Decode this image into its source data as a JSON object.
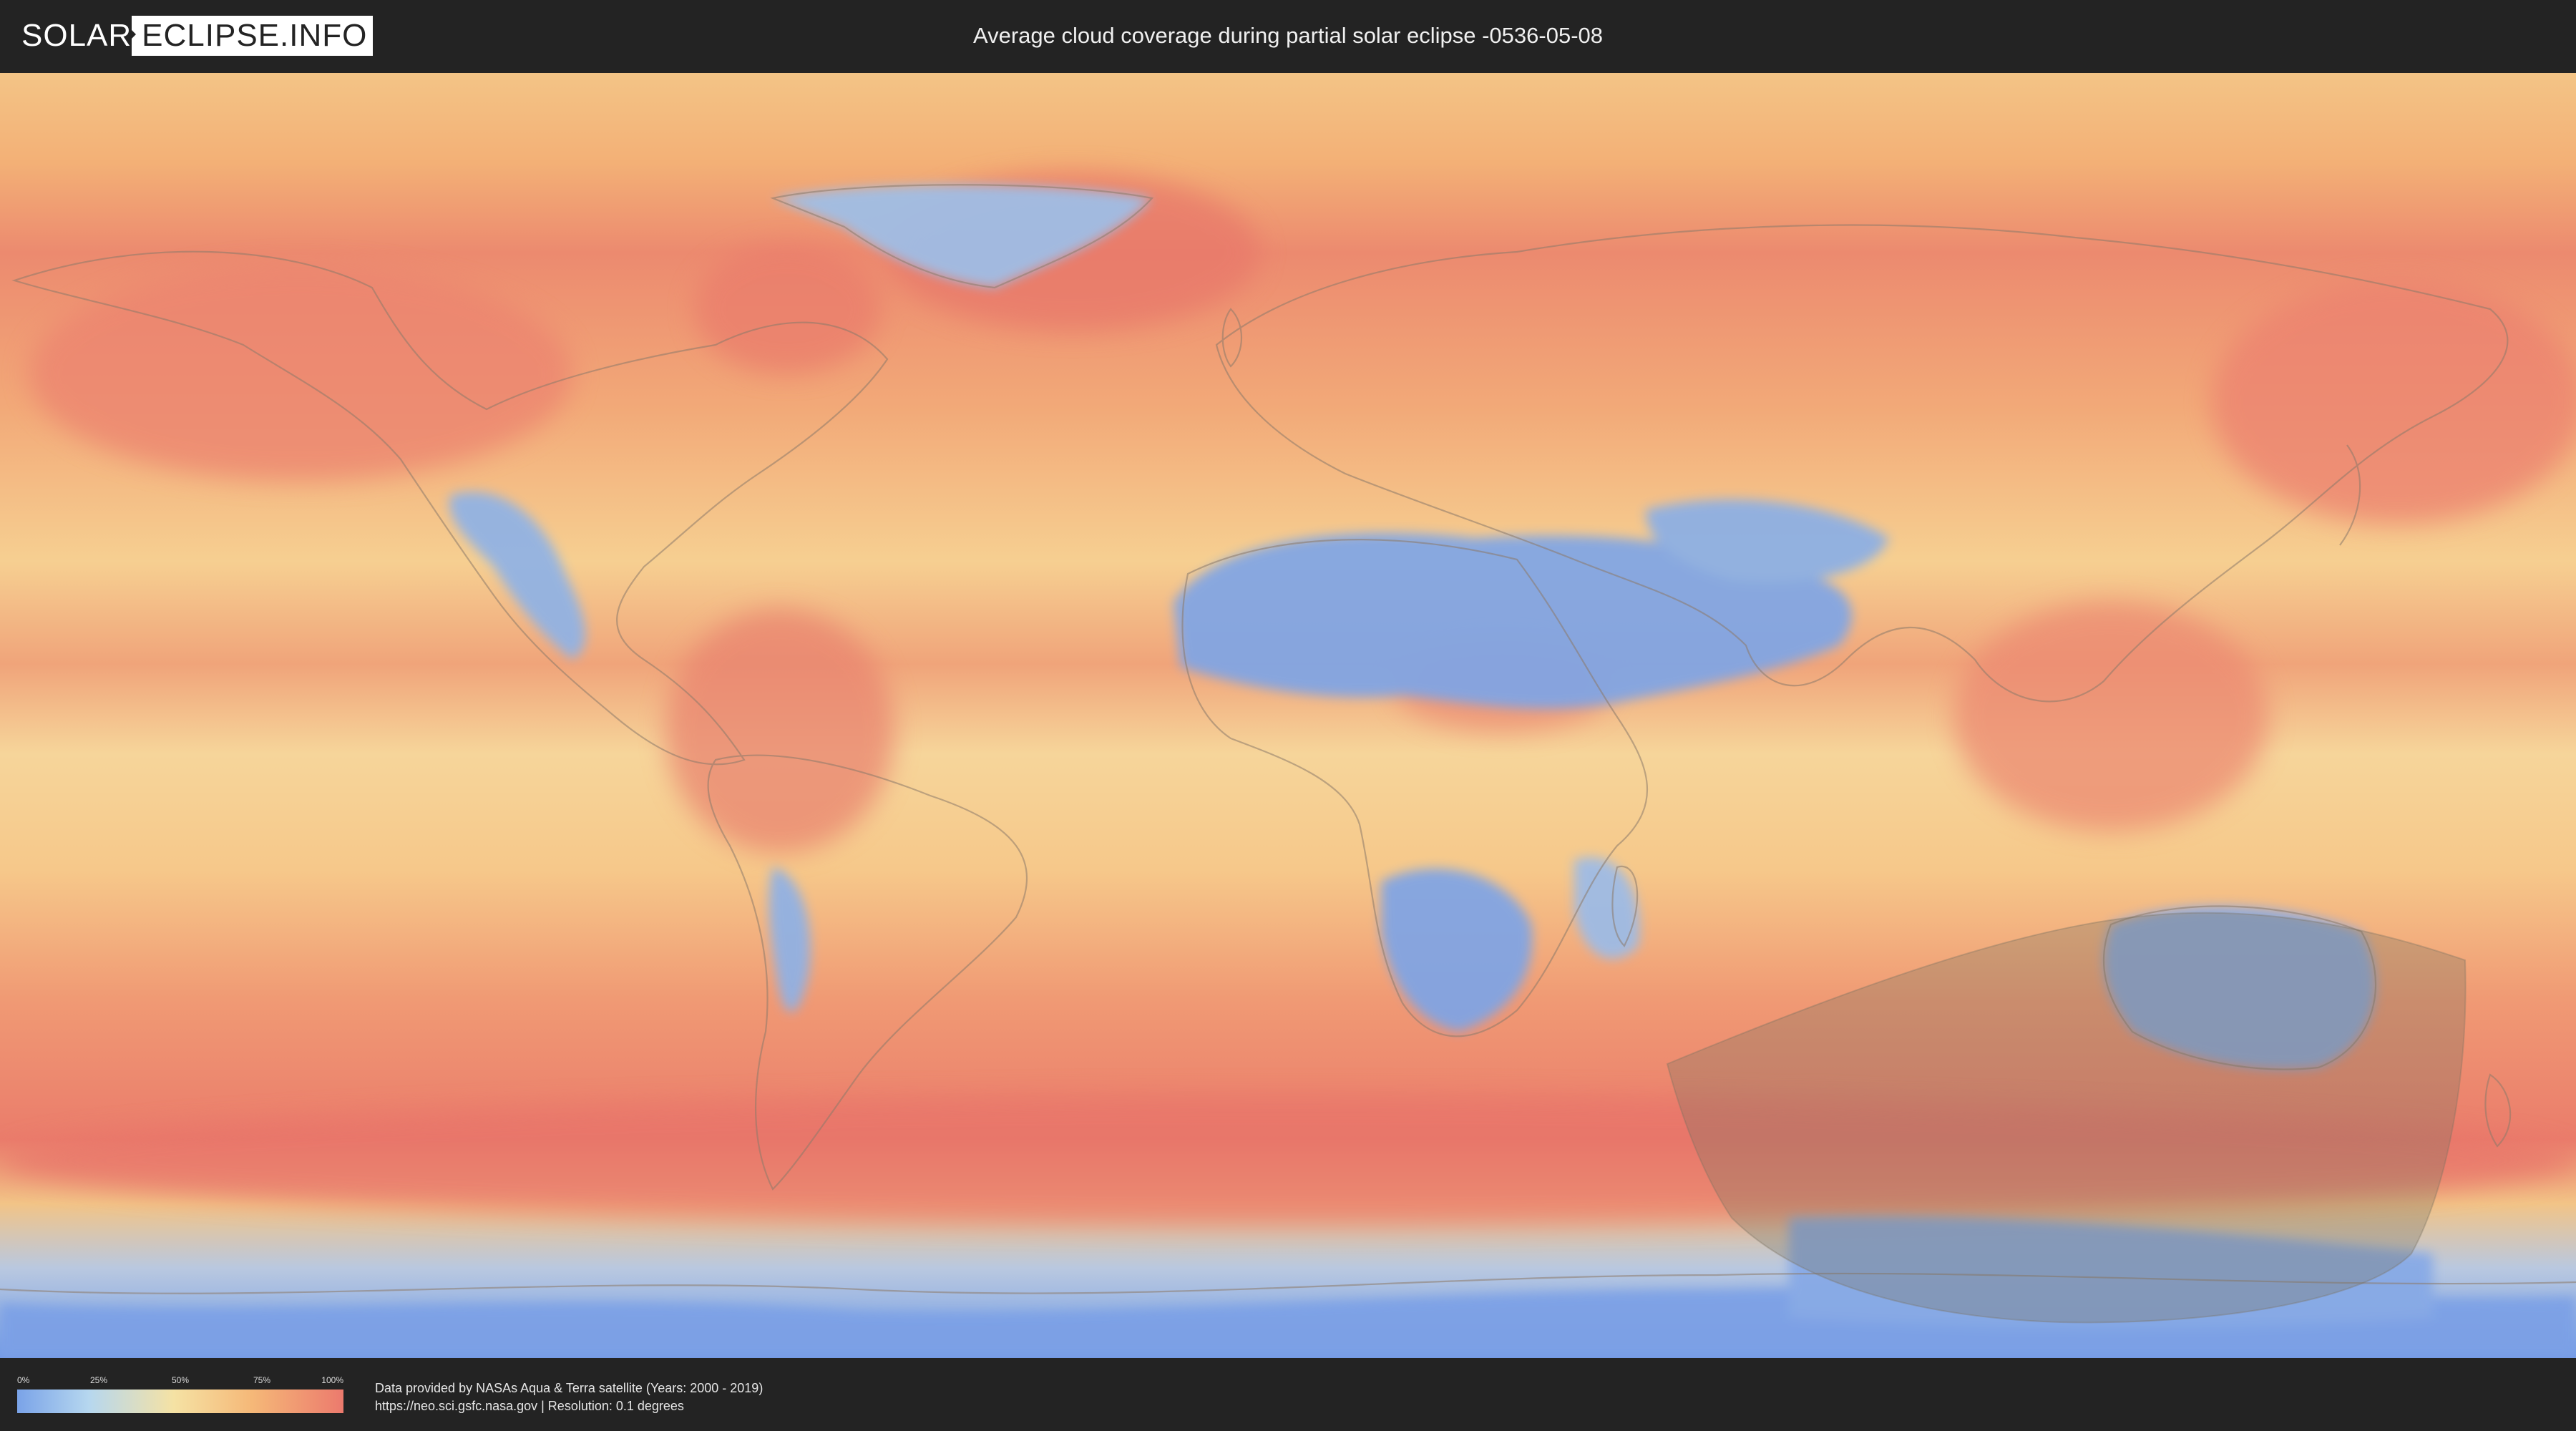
{
  "header": {
    "logo_left": "SOLAR",
    "logo_right": "ECLIPSE.INFO",
    "title": "Average cloud coverage during partial solar eclipse -0536-05-08"
  },
  "map": {
    "icon": "world-map-icon",
    "colors": {
      "ocean_cloudy": "#ec7a6d",
      "mid": "#f5c98c",
      "clear": "#7aa3e8",
      "eclipse_shadow": "#7a7460"
    }
  },
  "legend": {
    "ticks": [
      "0%",
      "25%",
      "50%",
      "75%",
      "100%"
    ],
    "gradient": [
      "#7aa3e8",
      "#b6d7ef",
      "#f5e2a4",
      "#f5b878",
      "#ec7a6d"
    ]
  },
  "credits": {
    "line1": "Data provided by NASAs Aqua & Terra satellite (Years: 2000 - 2019)",
    "line2": "https://neo.sci.gsfc.nasa.gov | Resolution: 0.1 degrees"
  }
}
